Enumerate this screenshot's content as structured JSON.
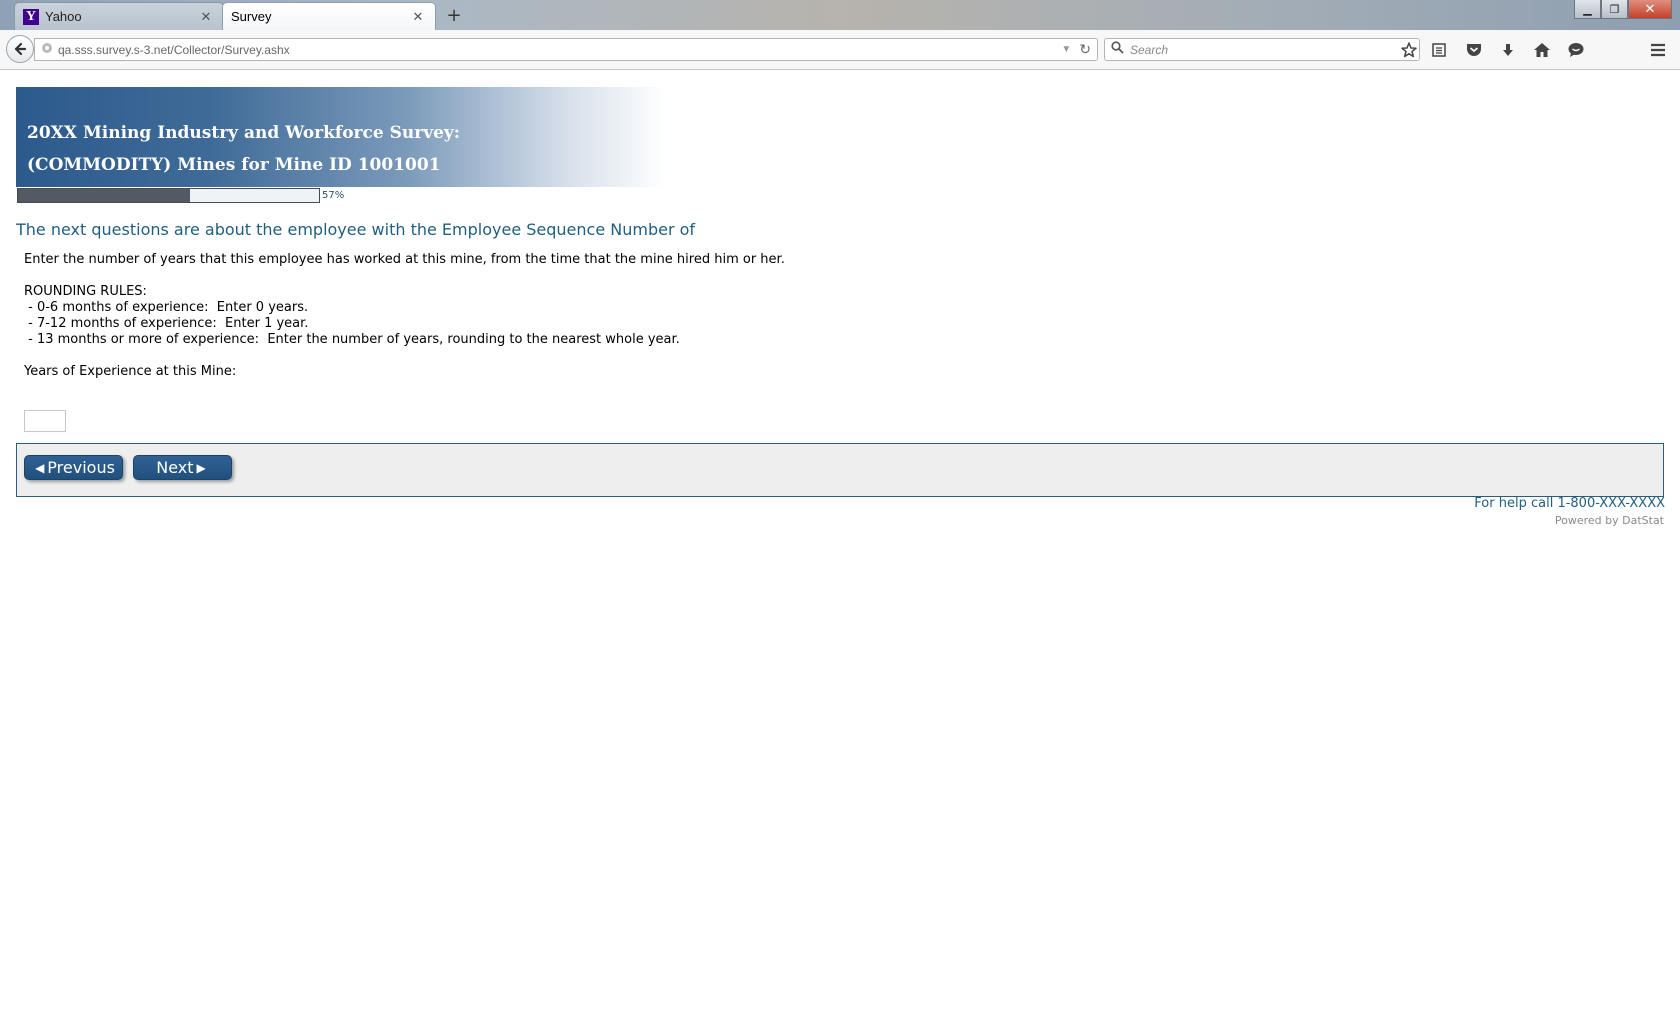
{
  "browser": {
    "tabs": [
      {
        "title": "Yahoo",
        "favicon": "Y",
        "active": false
      },
      {
        "title": "Survey",
        "active": true
      }
    ],
    "new_tab_label": "+",
    "window_controls": {
      "minimize": "▁",
      "maximize": "❐",
      "close": "✕"
    },
    "url": "qa.sss.survey.s-3.net/Collector/Survey.ashx",
    "search_placeholder": "Search",
    "icons": [
      "back-arrow-icon",
      "globe-icon",
      "reload-icon",
      "search-icon",
      "bookmark-star-icon",
      "reading-list-icon",
      "pocket-icon",
      "download-icon",
      "home-icon",
      "chat-icon",
      "menu-icon"
    ]
  },
  "survey": {
    "title_line1": "20XX Mining Industry and Workforce Survey:",
    "title_line2": "(COMMODITY) Mines for Mine ID 1001001",
    "progress": {
      "percent": 57,
      "label": "57%"
    },
    "heading": "The next questions are about the employee with the Employee Sequence Number of",
    "question": {
      "intro": "Enter the number of years that this employee has worked at this mine, from the time that the mine hired him or her.",
      "rules_title": "ROUNDING RULES:",
      "rules": [
        " - 0-6 months of experience:  Enter 0 years.",
        " - 7-12 months of experience:  Enter 1 year.",
        " - 13 months or more of experience:  Enter the number of years, rounding to the nearest whole year."
      ],
      "field_label": "Years of Experience at this Mine:",
      "field_value": ""
    },
    "buttons": {
      "previous": "Previous",
      "next": "Next"
    },
    "help_text": "For help call 1-800-XXX-XXXX",
    "powered_by": "Powered by DatStat"
  },
  "colors": {
    "banner_dark": "#2c5a8c",
    "heading_teal": "#1f5f7f",
    "button_blue": "#2a5a8a",
    "progress_fill": "#525b64",
    "panel_bg": "#eeeeee"
  }
}
